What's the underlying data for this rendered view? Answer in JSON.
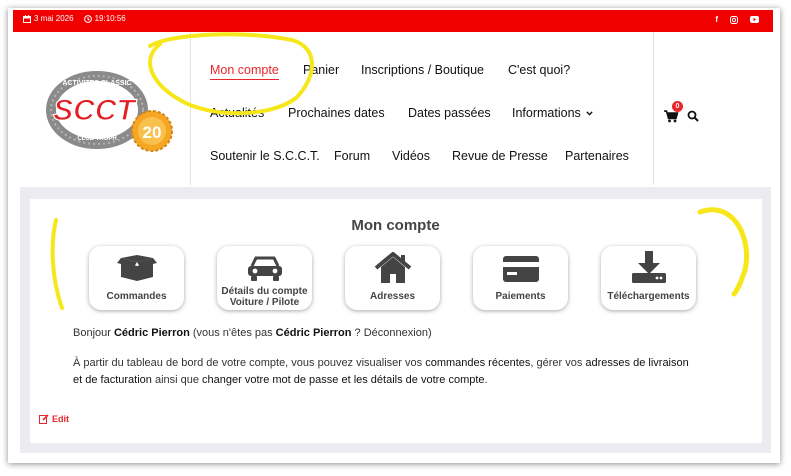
{
  "topbar": {
    "date": "3 mai 2026",
    "time": "19:10:56"
  },
  "logo": {
    "letters": "SCCT",
    "ring_text_top": "ACTIVITES CLASSIC",
    "ring_text_bottom": "CLUB TROPH",
    "anniversary": "20"
  },
  "nav": {
    "row1": [
      "Mon compte",
      "Panier",
      "Inscriptions / Boutique",
      "C'est quoi?"
    ],
    "row2": [
      "Actualités",
      "Prochaines dates",
      "Dates passées",
      "Informations"
    ],
    "row3": [
      "Soutenir le S.C.C.T.",
      "Forum",
      "Vidéos",
      "Revue de Presse",
      "Partenaires"
    ]
  },
  "cart": {
    "count": "0"
  },
  "account": {
    "title": "Mon compte",
    "tiles": [
      {
        "label": "Commandes",
        "icon": "box-icon"
      },
      {
        "label": "Détails du compte",
        "label2": "Voiture / Pilote",
        "icon": "car-icon"
      },
      {
        "label": "Adresses",
        "icon": "home-icon"
      },
      {
        "label": "Paiements",
        "icon": "credit-card-icon"
      },
      {
        "label": "Téléchargements",
        "icon": "download-icon"
      }
    ],
    "greeting": {
      "hello": "Bonjour ",
      "name": "Cédric Pierron",
      "mid": " (vous n'êtes pas ",
      "name2": "Cédric Pierron",
      "q": " ? ",
      "logout": "Déconnexion",
      "end": ")"
    },
    "dashboard": {
      "p1": "À partir du tableau de bord de votre compte, vous pouvez visualiser vos ",
      "l1": "commandes récentes",
      "p2": ", gérer vos ",
      "l2": "adresses de livraison",
      "p3": "et de facturation",
      "p4": " ainsi que ",
      "l3": "changer votre mot de passe et les détails de votre compte",
      "p5": "."
    },
    "edit": "Edit"
  },
  "colors": {
    "brand_red": "#f00000",
    "accent": "#e8262b",
    "annotation": "#f6e71a"
  }
}
